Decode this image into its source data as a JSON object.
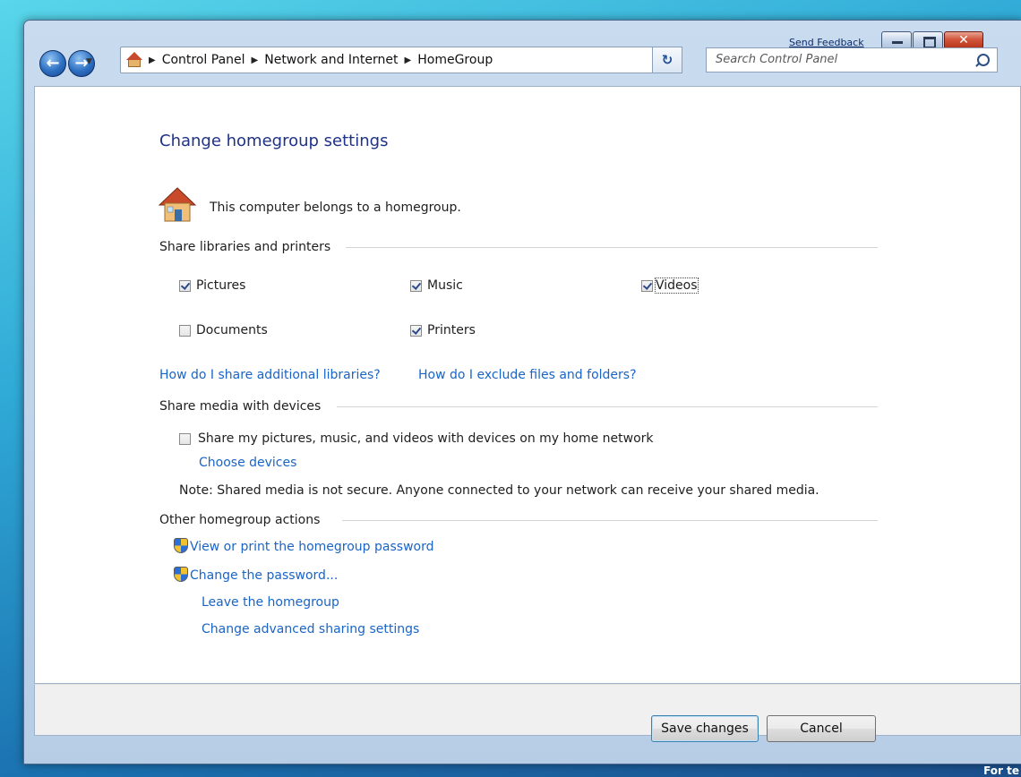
{
  "window": {
    "send_feedback": "Send Feedback",
    "close_glyph": "✕"
  },
  "nav": {
    "back_glyph": "←",
    "forward_glyph": "→",
    "breadcrumb": [
      "Control Panel",
      "Network and Internet",
      "HomeGroup"
    ],
    "search_placeholder": "Search Control Panel",
    "refresh_glyph": "↻"
  },
  "page": {
    "title": "Change homegroup settings",
    "belongs_text": "This computer belongs to a homegroup."
  },
  "share_libraries": {
    "heading": "Share libraries and printers",
    "items": [
      {
        "label": "Pictures",
        "checked": true
      },
      {
        "label": "Music",
        "checked": true
      },
      {
        "label": "Videos",
        "checked": true
      },
      {
        "label": "Documents",
        "checked": false
      },
      {
        "label": "Printers",
        "checked": true
      }
    ],
    "link_additional": "How do I share additional libraries?",
    "link_exclude": "How do I exclude files and folders?"
  },
  "share_media": {
    "heading": "Share media with devices",
    "checkbox_label": "Share my pictures, music, and videos with devices on my home network",
    "checkbox_checked": false,
    "choose_devices": "Choose devices",
    "note": "Note: Shared media is not secure. Anyone connected to your network can receive your shared media."
  },
  "other_actions": {
    "heading": "Other homegroup actions",
    "view_password": "View or print the homegroup password",
    "change_password": "Change the password...",
    "leave": "Leave the homegroup",
    "advanced": "Change advanced sharing settings"
  },
  "buttons": {
    "save": "Save changes",
    "cancel": "Cancel"
  },
  "desktop": {
    "corner_text": "For te"
  }
}
